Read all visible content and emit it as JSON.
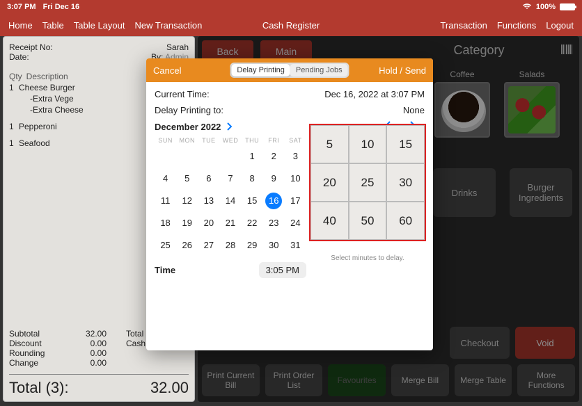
{
  "status": {
    "time": "3:07 PM",
    "date": "Fri Dec 16",
    "battery": "100%"
  },
  "nav": {
    "home": "Home",
    "table": "Table",
    "table_layout": "Table Layout",
    "new_tx": "New Transaction",
    "title": "Cash Register",
    "transaction": "Transaction",
    "functions": "Functions",
    "logout": "Logout"
  },
  "receipt": {
    "no_label": "Receipt No:",
    "date_label": "Date:",
    "server_name": "Sarah",
    "by_label": "By:",
    "by_value": "Admin",
    "qty_h": "Qty",
    "desc_h": "Description",
    "lines": [
      {
        "qty": "1",
        "desc": "Cheese Burger"
      },
      {
        "qty": "",
        "desc": "-Extra Vege"
      },
      {
        "qty": "",
        "desc": "-Extra Cheese"
      },
      {
        "qty": "1",
        "desc": "Pepperoni"
      },
      {
        "qty": "1",
        "desc": "Seafood"
      }
    ],
    "subtotal_l": "Subtotal",
    "subtotal_v": "32.00",
    "discount_l": "Discount",
    "discount_v": "0.00",
    "rounding_l": "Rounding",
    "rounding_v": "0.00",
    "change_l": "Change",
    "change_v": "0.00",
    "total_l2": "Total",
    "cash_l": "Cash",
    "grand_label": "Total (3):",
    "grand_value": "32.00"
  },
  "dark": {
    "back": "Back",
    "main": "Main",
    "category": "Category",
    "tiles": {
      "coffee": "Coffee",
      "salads": "Salads",
      "drinks": "Drinks",
      "burger": "Burger Ingredients"
    },
    "actions": {
      "print_bill": "Print Current Bill",
      "print_order": "Print Order List",
      "favourites": "Favourites",
      "merge_bill": "Merge Bill",
      "merge_table": "Merge Table",
      "more": "More Functions",
      "checkout": "Checkout",
      "void": "Void"
    }
  },
  "modal": {
    "cancel": "Cancel",
    "seg_delay": "Delay Printing",
    "seg_pending": "Pending Jobs",
    "hold_send": "Hold / Send",
    "current_time_l": "Current Time:",
    "current_time_v": "Dec 16, 2022 at 3:07 PM",
    "delay_to_l": "Delay Printing to:",
    "delay_to_v": "None",
    "month": "December 2022",
    "dow": [
      "SUN",
      "MON",
      "TUE",
      "WED",
      "THU",
      "FRI",
      "SAT"
    ],
    "days": [
      "",
      "",
      "",
      "",
      "1",
      "2",
      "3",
      "4",
      "5",
      "6",
      "7",
      "8",
      "9",
      "10",
      "11",
      "12",
      "13",
      "14",
      "15",
      "16",
      "17",
      "18",
      "19",
      "20",
      "21",
      "22",
      "23",
      "24",
      "25",
      "26",
      "27",
      "28",
      "29",
      "30",
      "31"
    ],
    "selected_day": "16",
    "time_l": "Time",
    "time_v": "3:05 PM",
    "delay_opts": [
      "5",
      "10",
      "15",
      "20",
      "25",
      "30",
      "40",
      "50",
      "60"
    ],
    "delay_caption": "Select minutes to delay."
  }
}
